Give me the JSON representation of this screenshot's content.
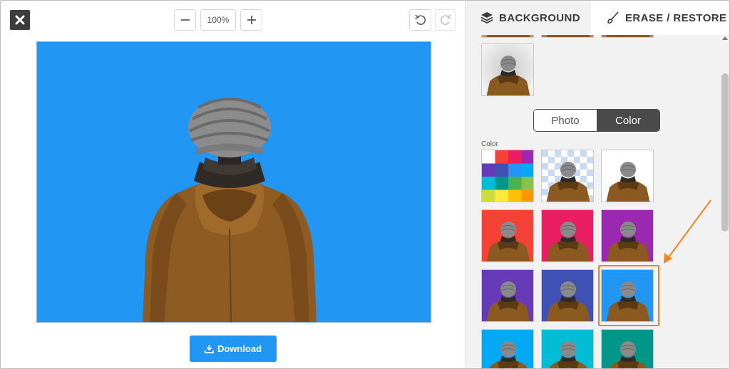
{
  "toolbar": {
    "zoom_level": "100%",
    "download_label": "Download"
  },
  "panel": {
    "tabs": [
      {
        "label": "BACKGROUND",
        "icon": "layers-icon"
      },
      {
        "label": "ERASE / RESTORE",
        "icon": "brush-icon"
      }
    ],
    "toggle": {
      "photo_label": "Photo",
      "color_label": "Color",
      "selected": "Color"
    },
    "color_section_label": "Color",
    "color_swatches": [
      {
        "type": "palette"
      },
      {
        "type": "transparent"
      },
      {
        "color": "#ffffff"
      },
      {
        "color": "#f44336"
      },
      {
        "color": "#e91e63"
      },
      {
        "color": "#9c27b0"
      },
      {
        "color": "#673ab7"
      },
      {
        "color": "#3f51b5"
      },
      {
        "color": "#2196f3",
        "selected": true
      },
      {
        "color": "#03a9f4"
      },
      {
        "color": "#00bcd4"
      },
      {
        "color": "#009688"
      }
    ],
    "palette_colors": [
      "#ffffff",
      "#f44336",
      "#e91e63",
      "#9c27b0",
      "#673ab7",
      "#3f51b5",
      "#2196f3",
      "#03a9f4",
      "#00bcd4",
      "#009688",
      "#4caf50",
      "#8bc34a",
      "#cddc39",
      "#ffeb3b",
      "#ffc107",
      "#ff9800"
    ]
  },
  "canvas": {
    "background_color": "#2196f3"
  },
  "accent_color": "#f5841f"
}
